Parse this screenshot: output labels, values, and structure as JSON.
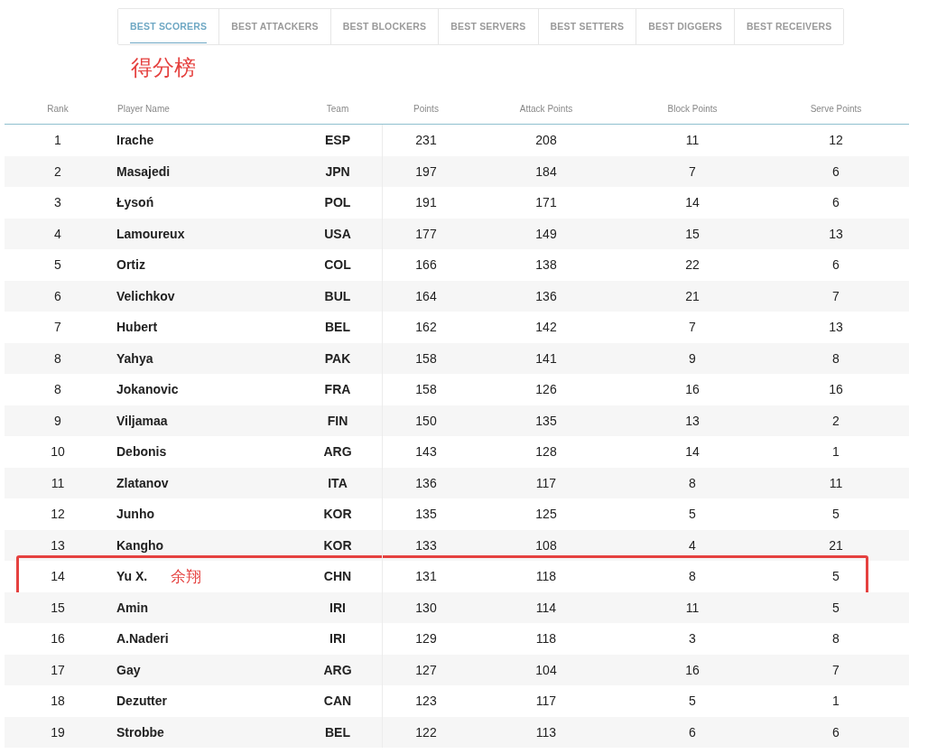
{
  "tabs": [
    {
      "label": "BEST SCORERS",
      "selected": true
    },
    {
      "label": "BEST ATTACKERS",
      "selected": false
    },
    {
      "label": "BEST BLOCKERS",
      "selected": false
    },
    {
      "label": "BEST SERVERS",
      "selected": false
    },
    {
      "label": "BEST SETTERS",
      "selected": false
    },
    {
      "label": "BEST DIGGERS",
      "selected": false
    },
    {
      "label": "BEST RECEIVERS",
      "selected": false
    }
  ],
  "heading": "得分榜",
  "table": {
    "columns": [
      "Rank",
      "Player Name",
      "Team",
      "Points",
      "Attack Points",
      "Block Points",
      "Serve Points"
    ],
    "rows": [
      {
        "cells": [
          "1",
          "Irache",
          "ESP",
          "231",
          "208",
          "11",
          "12"
        ],
        "circled": false
      },
      {
        "cells": [
          "2",
          "Masajedi",
          "JPN",
          "197",
          "184",
          "7",
          "6"
        ],
        "circled": false
      },
      {
        "cells": [
          "3",
          "Łysoń",
          "POL",
          "191",
          "171",
          "14",
          "6"
        ],
        "circled": false
      },
      {
        "cells": [
          "4",
          "Lamoureux",
          "USA",
          "177",
          "149",
          "15",
          "13"
        ],
        "circled": false
      },
      {
        "cells": [
          "5",
          "Ortiz",
          "COL",
          "166",
          "138",
          "22",
          "6"
        ],
        "circled": false
      },
      {
        "cells": [
          "6",
          "Velichkov",
          "BUL",
          "164",
          "136",
          "21",
          "7"
        ],
        "circled": false
      },
      {
        "cells": [
          "7",
          "Hubert",
          "BEL",
          "162",
          "142",
          "7",
          "13"
        ],
        "circled": false
      },
      {
        "cells": [
          "8",
          "Yahya",
          "PAK",
          "158",
          "141",
          "9",
          "8"
        ],
        "circled": false
      },
      {
        "cells": [
          "8",
          "Jokanovic",
          "FRA",
          "158",
          "126",
          "16",
          "16"
        ],
        "circled": false
      },
      {
        "cells": [
          "9",
          "Viljamaa",
          "FIN",
          "150",
          "135",
          "13",
          "2"
        ],
        "circled": false
      },
      {
        "cells": [
          "10",
          "Debonis",
          "ARG",
          "143",
          "128",
          "14",
          "1"
        ],
        "circled": false
      },
      {
        "cells": [
          "11",
          "Zlatanov",
          "ITA",
          "136",
          "117",
          "8",
          "11"
        ],
        "circled": false
      },
      {
        "cells": [
          "12",
          "Junho",
          "KOR",
          "135",
          "125",
          "5",
          "5"
        ],
        "circled": false
      },
      {
        "cells": [
          "13",
          "Kangho",
          "KOR",
          "133",
          "108",
          "4",
          "21"
        ],
        "circled": false
      },
      {
        "cells": [
          "14",
          "Yu X.",
          "CHN",
          "131",
          "118",
          "8",
          "5"
        ],
        "circled": true,
        "annotation": "余翔"
      },
      {
        "cells": [
          "15",
          "Amin",
          "IRI",
          "130",
          "114",
          "11",
          "5"
        ],
        "circled": false
      },
      {
        "cells": [
          "16",
          "A.Naderi",
          "IRI",
          "129",
          "118",
          "3",
          "8"
        ],
        "circled": false
      },
      {
        "cells": [
          "17",
          "Gay",
          "ARG",
          "127",
          "104",
          "16",
          "7"
        ],
        "circled": false
      },
      {
        "cells": [
          "18",
          "Dezutter",
          "CAN",
          "123",
          "117",
          "5",
          "1"
        ],
        "circled": false
      },
      {
        "cells": [
          "19",
          "Strobbe",
          "BEL",
          "122",
          "113",
          "6",
          "6"
        ],
        "circled": false
      }
    ]
  }
}
